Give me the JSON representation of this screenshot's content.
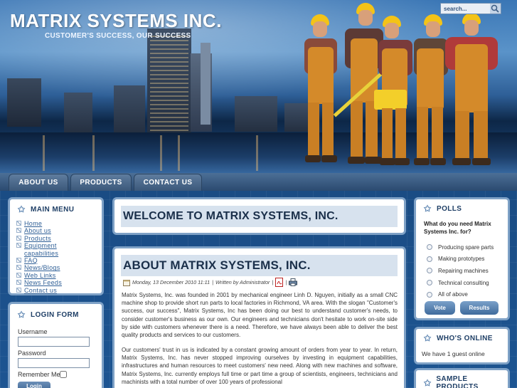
{
  "site": {
    "title": "MATRIX SYSTEMS INC.",
    "slogan": "CUSTOMER'S SUCCESS, OUR SUCCESS"
  },
  "search": {
    "value": "search..."
  },
  "nav": {
    "tabs": [
      "ABOUT US",
      "PRODUCTS",
      "CONTACT US"
    ]
  },
  "main_menu": {
    "title": "MAIN MENU",
    "items": [
      "Home",
      "About us",
      "Products",
      "Equipment capabilities",
      "FAQ",
      "News/Blogs",
      "Web Links",
      "News Feeds",
      "Contact us"
    ]
  },
  "login": {
    "title": "LOGIN FORM",
    "username_label": "Username",
    "password_label": "Password",
    "remember_label": "Remember Me",
    "button": "Login"
  },
  "welcome": {
    "title": "WELCOME TO MATRIX SYSTEMS, INC."
  },
  "article": {
    "title": "ABOUT MATRIX SYSTEMS, INC.",
    "date": "Monday, 13 December 2010 11:11",
    "author": "Written by Administrator",
    "paragraph1": "Matrix Systems, Inc. was founded in 2001 by mechanical engineer Linh D. Nguyen, initially as a small CNC machine shop to provide short run parts to local factories in Richmond, VA area. With the slogan \"Customer's success, our success\", Matrix Systems, Inc has been doing our best to understand customer's needs, to consider customer's business as our own. Our engineers and technicians don't hesitate to work on-site side by side with customers whenever there is a need. Therefore, we have always been able to deliver the best quality products and services to our customers.",
    "paragraph2": "Our customers' trust in us is indicated by a constant growing amount of orders from year to year. In return, Matrix Systems, Inc. has never stopped improving ourselves by investing in equipment capabilities, infrastructures and human resources to meet customers' new need. Along with new machines and software, Matrix Systems, Inc. currently employs full time or part time a group of scientists, engineers, technicians and machinists with a total number of over 100 years of professional"
  },
  "polls": {
    "title": "POLLS",
    "question": "What do you need Matrix Systems Inc. for?",
    "options": [
      "Producing spare parts",
      "Making prototypes",
      "Repairing machines",
      "Technical consulting",
      "All of above"
    ],
    "vote": "Vote",
    "results": "Results"
  },
  "online": {
    "title": "WHO'S ONLINE",
    "text": "We have 1 guest online"
  },
  "products": {
    "title": "SAMPLE PRODUCTS"
  },
  "icons": [
    "search-icon",
    "star-icon",
    "calendar-icon",
    "pdf-icon",
    "print-icon"
  ]
}
